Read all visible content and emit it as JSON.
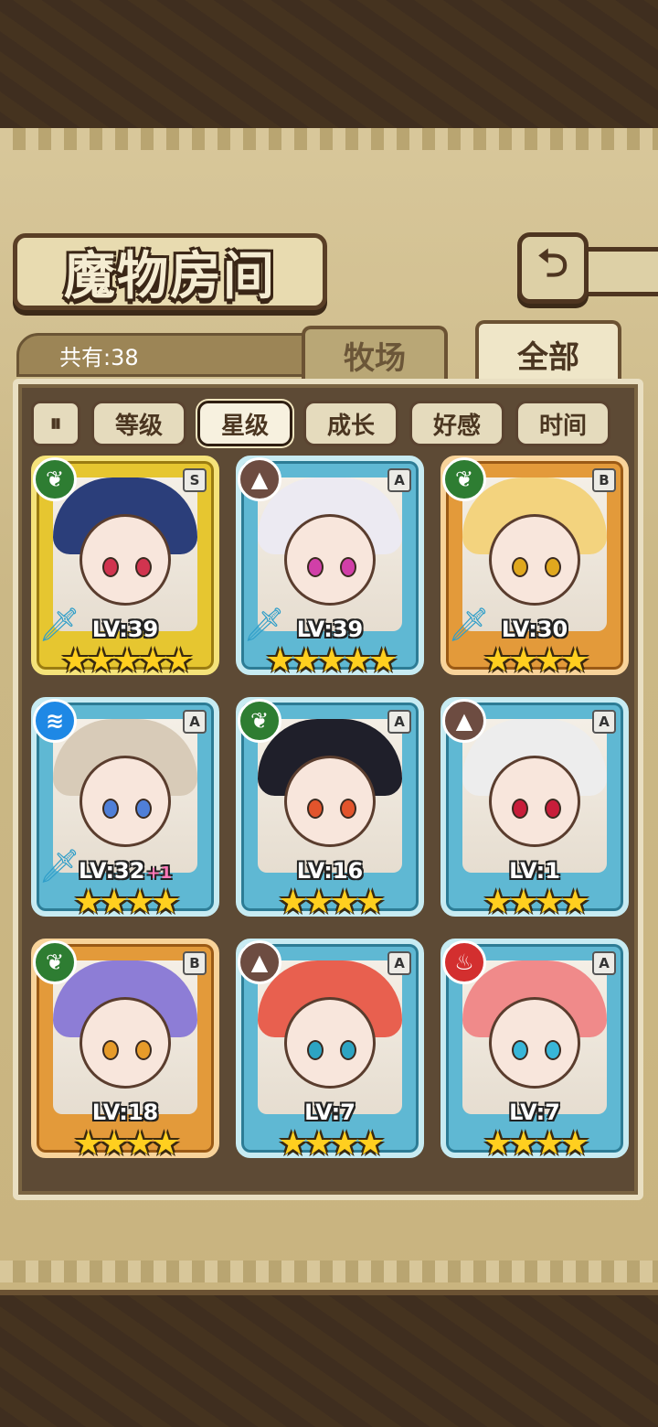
{
  "header": {
    "title": "魔物房间",
    "back_label": "⮌"
  },
  "summary": {
    "count_label": "共有:38"
  },
  "tabs": {
    "pasture": "牧场",
    "all": "全部"
  },
  "sort": {
    "toggle_label": "⏸",
    "options": [
      "等级",
      "星级",
      "成长",
      "好感",
      "时间"
    ],
    "active": "星级"
  },
  "monsters": [
    {
      "rank": "S",
      "element": "nature",
      "level": "LV:39",
      "plus": "",
      "stars": 5,
      "hair": "#2b3e7a",
      "eyes": "#d1344f",
      "sword": true
    },
    {
      "rank": "A",
      "element": "earth",
      "level": "LV:39",
      "plus": "",
      "stars": 5,
      "hair": "#eceaf2",
      "eyes": "#d13fa8",
      "sword": true
    },
    {
      "rank": "B",
      "element": "nature",
      "level": "LV:30",
      "plus": "",
      "stars": 4,
      "hair": "#f3d37e",
      "eyes": "#e0a81e",
      "sword": true
    },
    {
      "rank": "A",
      "element": "water",
      "level": "LV:32",
      "plus": "+1",
      "stars": 4,
      "hair": "#d8cbb8",
      "eyes": "#4f7fd8",
      "sword": true
    },
    {
      "rank": "A",
      "element": "nature",
      "level": "LV:16",
      "plus": "",
      "stars": 4,
      "hair": "#1f1f2a",
      "eyes": "#e2542c",
      "sword": false
    },
    {
      "rank": "A",
      "element": "earth",
      "level": "LV:1",
      "plus": "",
      "stars": 4,
      "hair": "#ededed",
      "eyes": "#c81d3a",
      "sword": false
    },
    {
      "rank": "B",
      "element": "nature",
      "level": "LV:18",
      "plus": "",
      "stars": 4,
      "hair": "#8d7dd6",
      "eyes": "#e69b2a",
      "sword": false
    },
    {
      "rank": "A",
      "element": "earth",
      "level": "LV:7",
      "plus": "",
      "stars": 4,
      "hair": "#e8604f",
      "eyes": "#2da4c2",
      "sword": false
    },
    {
      "rank": "A",
      "element": "fire",
      "level": "LV:7",
      "plus": "",
      "stars": 4,
      "hair": "#f08a8a",
      "eyes": "#38b6d8",
      "sword": false
    }
  ],
  "colors": {
    "frame": "#5d4a35",
    "star": "#ffcf1f",
    "rank_S": "#e6c630",
    "rank_A": "#5fb8d3",
    "rank_B": "#e39a3a"
  }
}
